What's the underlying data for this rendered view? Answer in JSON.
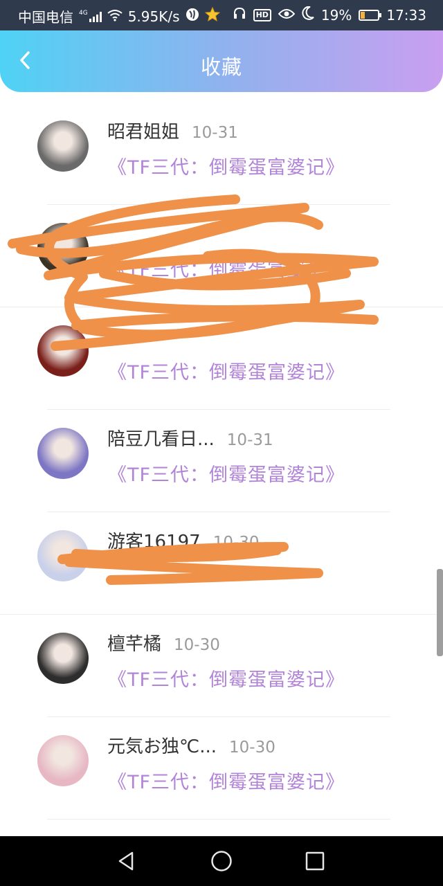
{
  "status_bar": {
    "carrier": "中国电信",
    "network": "4G",
    "speed": "5.95K/s",
    "battery": "19%",
    "time": "17:33",
    "hd_label": "HD",
    "icons": [
      "signal-icon",
      "wifi-icon",
      "browser-icon",
      "star-icon",
      "headphones-icon",
      "hd-icon",
      "eye-icon",
      "moon-icon",
      "battery-icon"
    ]
  },
  "header": {
    "title": "收藏",
    "back_icon": "back-chevron-icon"
  },
  "colors": {
    "gradient_start": "#4fd2f5",
    "gradient_end": "#c99ff0",
    "book_title": "#b184d8",
    "name": "#333333",
    "date": "#9a9a9a",
    "scribble": "#f0914a"
  },
  "items": [
    {
      "name": "昭君姐姐",
      "date": "10-31",
      "book": "《TF三代：倒霉蛋富婆记》",
      "avatar_color": "#6a6a6a"
    },
    {
      "name": "",
      "date": "",
      "book": "《TF三代：倒霉蛋富婆记》",
      "avatar_color": "#3b3226",
      "obscured": true
    },
    {
      "name": "",
      "date": "",
      "book": "《TF三代：倒霉蛋富婆记》",
      "avatar_color": "#7a1f1a",
      "obscured": true
    },
    {
      "name": "陪豆几看日...",
      "date": "10-31",
      "book": "《TF三代：倒霉蛋富婆记》",
      "avatar_color": "#7d76c4"
    },
    {
      "name": "游客16197",
      "date": "10-30",
      "book": "",
      "avatar_color": "#c9d0ea",
      "obscured": true
    },
    {
      "name": "檀芊橘",
      "date": "10-30",
      "book": "《TF三代：倒霉蛋富婆记》",
      "avatar_color": "#2d2d2d"
    },
    {
      "name": "元気お独℃...",
      "date": "10-30",
      "book": "《TF三代：倒霉蛋富婆记》",
      "avatar_color": "#e7b7c4"
    }
  ],
  "nav_bar": {
    "icons": [
      "back-triangle-icon",
      "home-circle-icon",
      "recents-square-icon"
    ]
  }
}
